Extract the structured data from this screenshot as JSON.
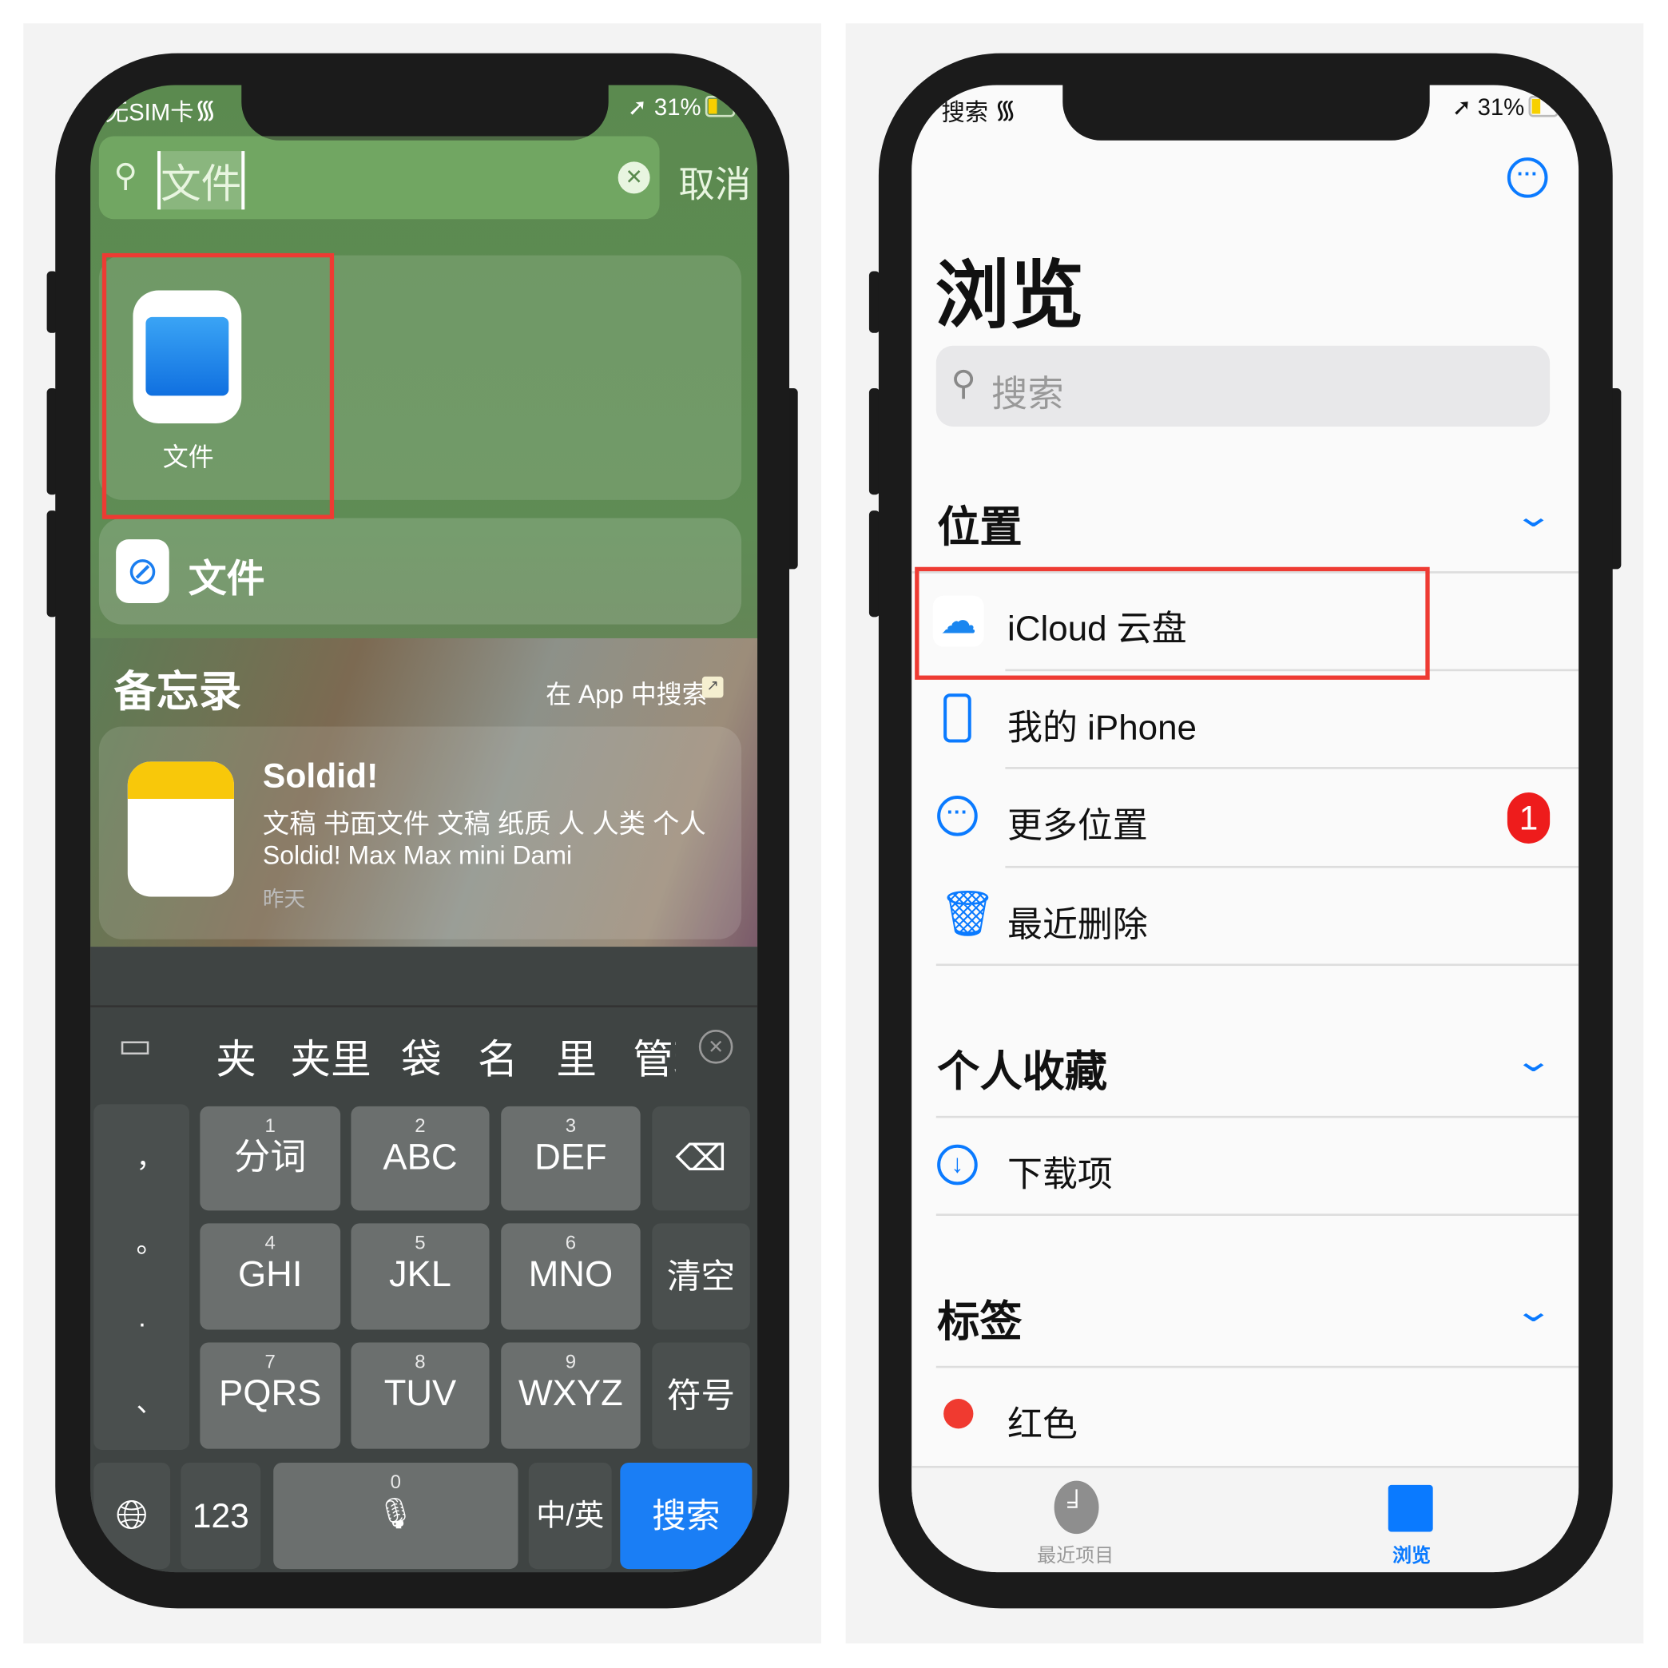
{
  "left_phone": {
    "status": {
      "carrier": "无SIM卡",
      "battery": "31%"
    },
    "search": {
      "value": "文件",
      "cancel": "取消"
    },
    "top_hit": {
      "label": "文件"
    },
    "suggestion": {
      "label": "文件"
    },
    "notes_section": {
      "title": "备忘录",
      "search_in_app": "在 App 中搜索",
      "note": {
        "title": "Soldid!",
        "line1": "文稿 书面文件 文稿 纸质 人 人类 个人",
        "line2": "Soldid! Max Max mini Dami",
        "date": "昨天"
      }
    },
    "keyboard": {
      "candidates": [
        "夹",
        "夹里",
        "袋",
        "名",
        "里",
        "管理"
      ],
      "punctuation": [
        "，",
        "。",
        ".",
        "、"
      ],
      "keys": [
        {
          "num": "1",
          "label": "分词"
        },
        {
          "num": "2",
          "label": "ABC"
        },
        {
          "num": "3",
          "label": "DEF"
        },
        {
          "num": "4",
          "label": "GHI"
        },
        {
          "num": "5",
          "label": "JKL"
        },
        {
          "num": "6",
          "label": "MNO"
        },
        {
          "num": "7",
          "label": "PQRS"
        },
        {
          "num": "8",
          "label": "TUV"
        },
        {
          "num": "9",
          "label": "WXYZ"
        }
      ],
      "clear": "清空",
      "symbols": "符号",
      "numbers": "123",
      "space_num": "0",
      "lang": "中/英",
      "search": "搜索"
    }
  },
  "right_phone": {
    "status": {
      "back": "搜索",
      "battery": "31%"
    },
    "title": "浏览",
    "search_placeholder": "搜索",
    "sections": {
      "locations": {
        "title": "位置",
        "items": [
          "iCloud 云盘",
          "我的 iPhone",
          "更多位置",
          "最近删除"
        ],
        "badge": "1"
      },
      "favorites": {
        "title": "个人收藏",
        "items": [
          "下载项"
        ]
      },
      "tags": {
        "title": "标签",
        "items": [
          "红色"
        ]
      }
    },
    "tabs": [
      {
        "label": "最近项目"
      },
      {
        "label": "浏览"
      }
    ],
    "colors": {
      "accent": "#0a7aff",
      "badge": "#ee1c1c",
      "highlight": "#ee3b33"
    }
  }
}
